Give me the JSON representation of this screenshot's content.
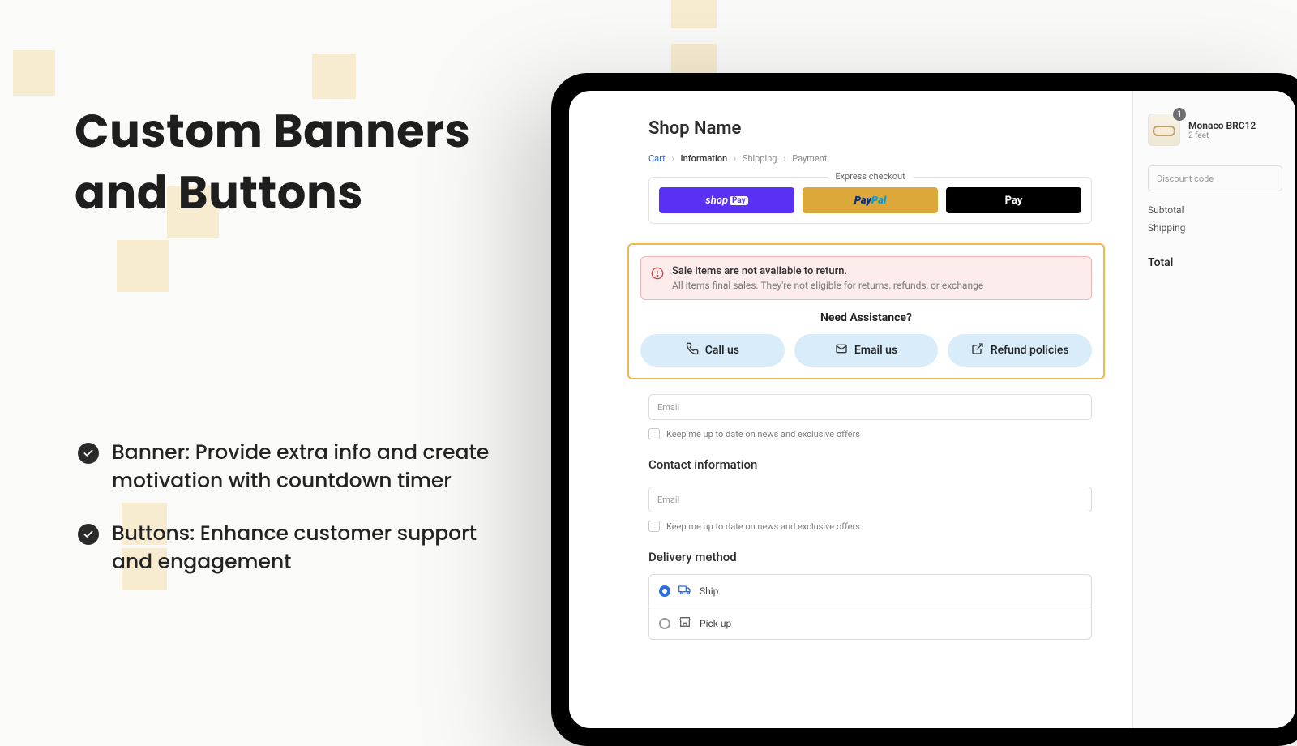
{
  "hero": {
    "title_l1": "Custom Banners",
    "title_l2": "and Buttons"
  },
  "features": [
    "Banner: Provide extra info and create motivation with countdown timer",
    "Buttons: Enhance customer support and engagement"
  ],
  "checkout": {
    "shop_name": "Shop Name",
    "breadcrumbs": {
      "cart": "Cart",
      "information": "Information",
      "shipping": "Shipping",
      "payment": "Payment"
    },
    "express_label": "Express checkout",
    "express_buttons": {
      "shop_pay": "shop",
      "shop_pay_suffix": "Pay",
      "paypal_p": "Pay",
      "paypal_pal": "Pal",
      "apple_pay": " Pay"
    },
    "banner": {
      "title": "Sale items are not available to return.",
      "desc": "All items final sales. They're not eligible for returns, refunds, or exchange"
    },
    "assist_heading": "Need Assistance?",
    "assist_buttons": {
      "call": "Call us",
      "email": "Email us",
      "refund": "Refund policies"
    },
    "fields": {
      "email_placeholder": "Email",
      "news_checkbox": "Keep me up to date on news and exclusive offers",
      "contact_heading": "Contact information",
      "delivery_heading": "Delivery method",
      "ship": "Ship",
      "pickup": "Pick up"
    }
  },
  "sidebar": {
    "product": {
      "name": "Monaco BRC12",
      "variant": "2 feet",
      "qty": "1"
    },
    "discount_placeholder": "Discount code",
    "subtotal_label": "Subtotal",
    "shipping_label": "Shipping",
    "total_label": "Total"
  }
}
